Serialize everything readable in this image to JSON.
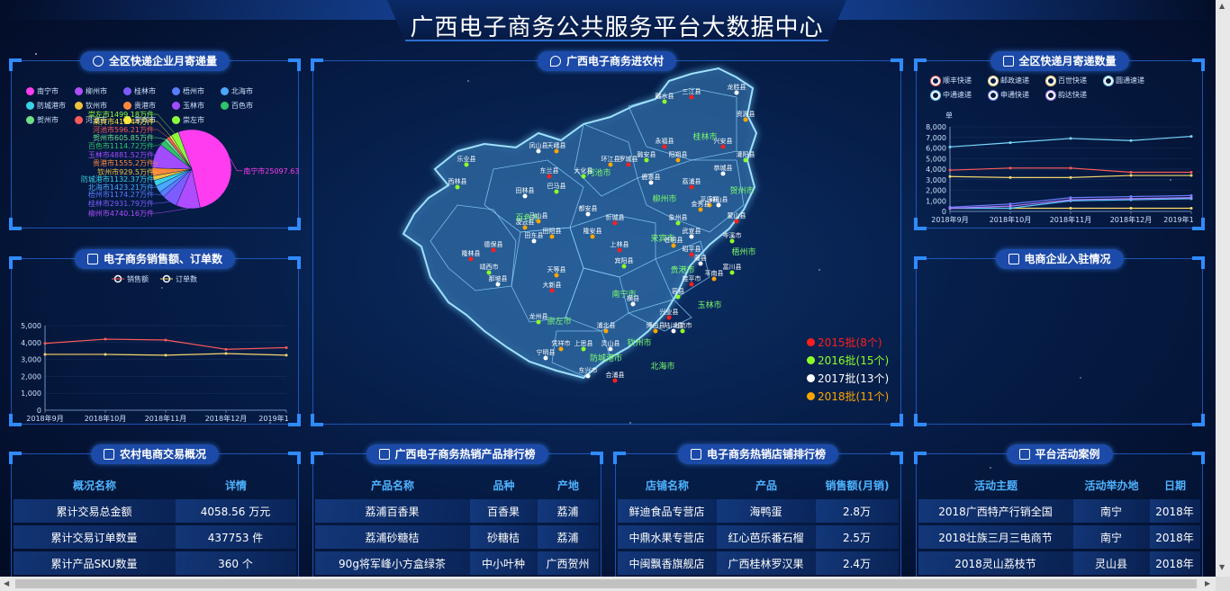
{
  "header": {
    "title": "广西电子商务公共服务平台大数据中心"
  },
  "express_volume": {
    "title": "全区快递企业月寄递量",
    "legend": [
      {
        "name": "南宁市",
        "color": "#ff3cf0"
      },
      {
        "name": "柳州市",
        "color": "#b04cff"
      },
      {
        "name": "桂林市",
        "color": "#7d5cff"
      },
      {
        "name": "梧州市",
        "color": "#5a7dff"
      },
      {
        "name": "北海市",
        "color": "#4aa8ff"
      },
      {
        "name": "防城港市",
        "color": "#3cd2e6"
      },
      {
        "name": "钦州市",
        "color": "#f0c23c"
      },
      {
        "name": "贵港市",
        "color": "#ff8a3c"
      },
      {
        "name": "玉林市",
        "color": "#a14cff"
      },
      {
        "name": "百色市",
        "color": "#2fc46a"
      },
      {
        "name": "贺州市",
        "color": "#6ee08a"
      },
      {
        "name": "河池市",
        "color": "#ff5a5a"
      },
      {
        "name": "来宾市",
        "color": "#ffe73c"
      },
      {
        "name": "崇左市",
        "color": "#8cff3c"
      }
    ],
    "chart_data": {
      "type": "pie",
      "unit": "万件",
      "slices": [
        {
          "name": "南宁市",
          "value": 25097.63,
          "label": "南宁市25097.63万件"
        },
        {
          "name": "柳州市",
          "value": 4740.16,
          "label": "柳州市4740.16万件"
        },
        {
          "name": "桂林市",
          "value": 2931.79,
          "label": "桂林市2931.79万件"
        },
        {
          "name": "梧州市",
          "value": 1174.27,
          "label": "梧州市1174.27万件"
        },
        {
          "name": "北海市",
          "value": 1423.21,
          "label": "北海市1423.21万件"
        },
        {
          "name": "防城港市",
          "value": 1132.37,
          "label": "防城港市1132.37万件"
        },
        {
          "name": "钦州市",
          "value": 929.5,
          "label": "钦州市929.5万件"
        },
        {
          "name": "贵港市",
          "value": 1555.2,
          "label": "贵港市1555.2万件"
        },
        {
          "name": "玉林市",
          "value": 4881.52,
          "label": "玉林市4881.52万件"
        },
        {
          "name": "百色市",
          "value": 1114.72,
          "label": "百色市1114.72万件"
        },
        {
          "name": "贺州市",
          "value": 605.85,
          "label": "贺州市605.85万件"
        },
        {
          "name": "河池市",
          "value": 596.21,
          "label": "河池市596.21万件"
        },
        {
          "name": "来宾市",
          "value": 419.44,
          "label": "来宾市419.44万件"
        },
        {
          "name": "崇左市",
          "value": 1499.18,
          "label": "崇左市1499.18万件"
        }
      ]
    }
  },
  "sales": {
    "title": "电子商务销售额、订单数",
    "chart_data": {
      "type": "line",
      "categories": [
        "2018年9月",
        "2018年10月",
        "2018年11月",
        "2018年12月",
        "2019年1"
      ],
      "ylim": [
        0,
        5000
      ],
      "yticks": [
        "5,000",
        "4,000",
        "3,000",
        "2,000",
        "1,000",
        "0"
      ],
      "series": [
        {
          "name": "销售额",
          "color": "#ff5b5b",
          "values": [
            3950,
            4200,
            4150,
            3600,
            3700
          ]
        },
        {
          "name": "订单数",
          "color": "#f5d76e",
          "values": [
            3300,
            3300,
            3250,
            3350,
            3250
          ]
        }
      ]
    }
  },
  "map": {
    "title": "广西电子商务进农村",
    "cities": [
      "桂林市",
      "河池市",
      "柳州市",
      "贺州市",
      "百色市",
      "来宾市",
      "梧州市",
      "南宁市",
      "贵港市",
      "崇左市",
      "玉林市",
      "钦州市",
      "防城港市",
      "北海市"
    ],
    "counties": [
      "三江县",
      "融水县",
      "龙胜县",
      "资源县",
      "兴安县",
      "灌阳县",
      "恭城县",
      "平乐县",
      "荔浦县",
      "乐业县",
      "凤山县",
      "天峨县",
      "东兰县",
      "巴马县",
      "都安县",
      "马山县",
      "隆林县",
      "西林县",
      "田林县",
      "凌云县",
      "德保县",
      "靖西市",
      "那坡县",
      "天等县",
      "大新县",
      "龙州县",
      "宁明县",
      "凭祥市",
      "上林县",
      "宾阳县",
      "横县",
      "隆安县",
      "忻城县",
      "象州县",
      "武宣县",
      "金秀县",
      "蒙山县",
      "岑溪市",
      "藤县",
      "苍梧县",
      "昭平县",
      "富川县",
      "钟山县",
      "平南县",
      "桂平市",
      "容县",
      "陆川县",
      "博白县",
      "兴业县",
      "北流市",
      "灵山县",
      "浦北县",
      "合浦县",
      "上思县",
      "东兴市",
      "环江县",
      "罗城县",
      "融安县",
      "鹿寨县",
      "阳朔县",
      "永福县",
      "大化县",
      "田东县",
      "田阳县"
    ],
    "legend": [
      {
        "label": "2015批(8个)",
        "color": "#ff1e1e"
      },
      {
        "label": "2016批(15个)",
        "color": "#8cff2a"
      },
      {
        "label": "2017批(13个)",
        "color": "#ffffff"
      },
      {
        "label": "2018批(11个)",
        "color": "#ffa500"
      }
    ]
  },
  "express_count": {
    "title": "全区快递月寄递数量",
    "unit": "单",
    "legend": [
      {
        "name": "顺丰快递",
        "color": "#ff5b5b"
      },
      {
        "name": "邮政速递",
        "color": "#f5d76e"
      },
      {
        "name": "百世快递",
        "color": "#ffe066"
      },
      {
        "name": "圆通速递",
        "color": "#79d8ff"
      },
      {
        "name": "中通速递",
        "color": "#5bc8ff"
      },
      {
        "name": "申通快递",
        "color": "#6c7dff"
      },
      {
        "name": "韵达快递",
        "color": "#b07cff"
      }
    ],
    "chart_data": {
      "type": "line",
      "categories": [
        "2018年9月",
        "2018年10月",
        "2018年11月",
        "2018年12月",
        "2019年1"
      ],
      "ylim": [
        0,
        8000
      ],
      "yticks": [
        "8,000",
        "7,000",
        "6,000",
        "5,000",
        "4,000",
        "3,000",
        "2,000",
        "1,000",
        "0"
      ],
      "series": [
        {
          "name": "顺丰快递",
          "color": "#ff5b5b",
          "values": [
            3900,
            4100,
            4100,
            3700,
            3700
          ]
        },
        {
          "name": "邮政速递",
          "color": "#f5d76e",
          "values": [
            3300,
            3200,
            3200,
            3400,
            3400
          ]
        },
        {
          "name": "百世快递",
          "color": "#ffe066",
          "values": [
            300,
            300,
            300,
            300,
            300
          ]
        },
        {
          "name": "圆通速递",
          "color": "#79d8ff",
          "values": [
            6100,
            6500,
            6900,
            6700,
            7100
          ]
        },
        {
          "name": "中通速递",
          "color": "#5bc8ff",
          "values": [
            300,
            300,
            1000,
            1100,
            1200
          ]
        },
        {
          "name": "申通快递",
          "color": "#6c7dff",
          "values": [
            400,
            700,
            1300,
            1400,
            1500
          ]
        },
        {
          "name": "韵达快递",
          "color": "#b07cff",
          "values": [
            300,
            500,
            1100,
            1200,
            1300
          ]
        }
      ]
    }
  },
  "enterprise": {
    "title": "电商企业入驻情况"
  },
  "rural": {
    "title": "农村电商交易概况",
    "headers": [
      "概况名称",
      "详情"
    ],
    "rows": [
      [
        "累计交易总金额",
        "4058.56 万元"
      ],
      [
        "累计交易订单数量",
        "437753 件"
      ],
      [
        "累计产品SKU数量",
        "360 个"
      ]
    ]
  },
  "hot_products": {
    "title": "广西电子商务热销产品排行榜",
    "headers": [
      "产品名称",
      "品种",
      "产地"
    ],
    "rows": [
      [
        "荔浦百香果",
        "百香果",
        "荔浦"
      ],
      [
        "荔浦砂糖桔",
        "砂糖桔",
        "荔浦"
      ],
      [
        "90g将军峰小方盒绿茶",
        "中小叶种",
        "广西贺州"
      ]
    ]
  },
  "hot_shops": {
    "title": "电子商务热销店铺排行榜",
    "headers": [
      "店铺名称",
      "产品",
      "销售额(月销)"
    ],
    "rows": [
      [
        "鲜迪食品专营店",
        "海鸭蛋",
        "2.8万"
      ],
      [
        "中鼎水果专营店",
        "红心芭乐番石榴",
        "2.5万"
      ],
      [
        "中闽飘香旗舰店",
        "广西桂林罗汉果",
        "2.4万"
      ]
    ]
  },
  "activities": {
    "title": "平台活动案例",
    "headers": [
      "活动主题",
      "活动举办地",
      "日期"
    ],
    "rows": [
      [
        "2018广西特产行销全国",
        "南宁",
        "2018年"
      ],
      [
        "2018壮族三月三电商节",
        "南宁",
        "2018年"
      ],
      [
        "2018灵山荔枝节",
        "灵山县",
        "2018年"
      ]
    ]
  }
}
